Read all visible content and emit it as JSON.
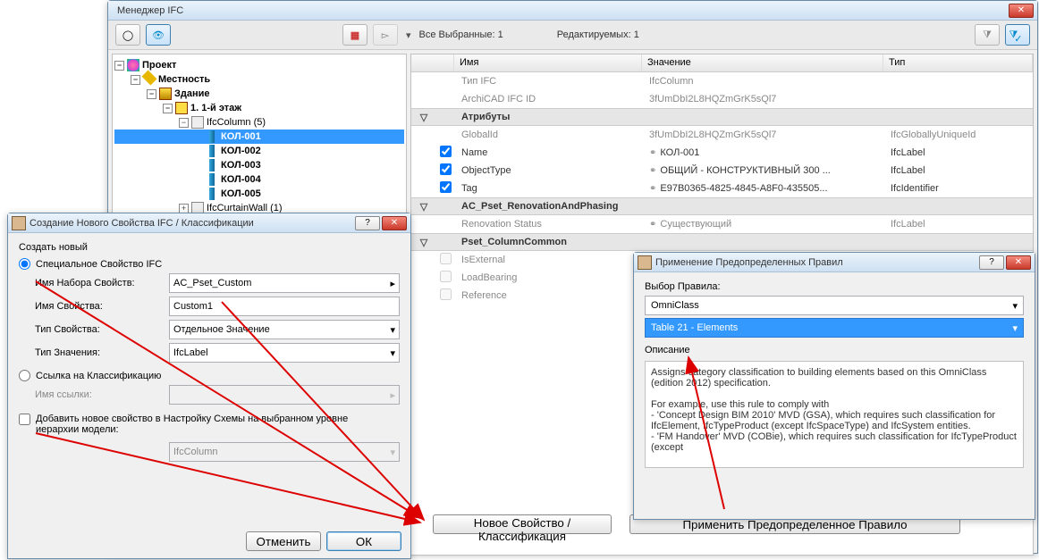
{
  "main": {
    "title": "Менеджер IFC",
    "status": {
      "selected": "Все Выбранные: 1",
      "editable": "Редактируемых: 1"
    },
    "tree": {
      "project": "Проект",
      "site": "Местность",
      "building": "Здание",
      "floor": "1. 1-й этаж",
      "col_group": "IfcColumn (5)",
      "cols": [
        "КОЛ-001",
        "КОЛ-002",
        "КОЛ-003",
        "КОЛ-004",
        "КОЛ-005"
      ],
      "cw_group": "IfcCurtainWall (1)"
    },
    "grid": {
      "headers": {
        "name": "Имя",
        "value": "Значение",
        "type": "Тип"
      },
      "r_type": {
        "name": "Тип IFC",
        "value": "IfcColumn"
      },
      "r_id": {
        "name": "ArchiCAD IFC ID",
        "value": "3fUmDbI2L8HQZmGrK5sQl7"
      },
      "g_attrs": "Атрибуты",
      "r_gid": {
        "name": "GlobalId",
        "value": "3fUmDbI2L8HQZmGrK5sQl7",
        "type": "IfcGloballyUniqueId"
      },
      "r_name": {
        "name": "Name",
        "value": "КОЛ-001",
        "type": "IfcLabel"
      },
      "r_ot": {
        "name": "ObjectType",
        "value": "ОБЩИЙ - КОНСТРУКТИВНЫЙ 300 ...",
        "type": "IfcLabel"
      },
      "r_tag": {
        "name": "Tag",
        "value": "E97B0365-4825-4845-A8F0-435505...",
        "type": "IfcIdentifier"
      },
      "g_reno": "AC_Pset_RenovationAndPhasing",
      "r_reno": {
        "name": "Renovation Status",
        "value": "Существующий",
        "type": "IfcLabel"
      },
      "g_colcommon": "Pset_ColumnCommon",
      "r_ext": {
        "name": "IsExternal"
      },
      "r_lb": {
        "name": "LoadBearing"
      },
      "r_ref": {
        "name": "Reference"
      }
    },
    "buttons": {
      "newprop": "Новое Свойство / Классификация",
      "applyrule": "Применить Предопределенное Правило"
    }
  },
  "dlg1": {
    "title": "Создание Нового Свойства IFC / Классификации",
    "create_new": "Создать новый",
    "radio_prop": "Специальное Свойство IFC",
    "lbl_pset": "Имя Набора Свойств:",
    "val_pset": "AC_Pset_Custom",
    "lbl_pname": "Имя Свойства:",
    "val_pname": "Custom1",
    "lbl_ptype": "Тип Свойства:",
    "val_ptype": "Отдельное Значение",
    "lbl_vtype": "Тип Значения:",
    "val_vtype": "IfcLabel",
    "radio_classif": "Ссылка на Классификацию",
    "lbl_linkname": "Имя ссылки:",
    "chk_add": "Добавить новое свойство в Настройку Схемы на выбранном уровне иерархии модели:",
    "val_ifccol": "IfcColumn",
    "btn_cancel": "Отменить",
    "btn_ok": "ОК"
  },
  "dlg2": {
    "title": "Применение Предопределенных Правил",
    "lbl_choose": "Выбор Правила:",
    "combo1": "OmniClass",
    "combo2": "Table 21 - Elements",
    "lbl_desc": "Описание",
    "desc": "Assigns category classification to building elements based on this OmniClass (edition 2012) specification.\n\nFor example, use this rule to comply with\n- 'Concept Design BIM 2010' MVD (GSA), which requires such classification for IfcElement, IfcTypeProduct (except IfcSpaceType) and IfcSystem entities.\n- 'FM Handover' MVD (COBie), which requires such classification for IfcTypeProduct (except"
  }
}
